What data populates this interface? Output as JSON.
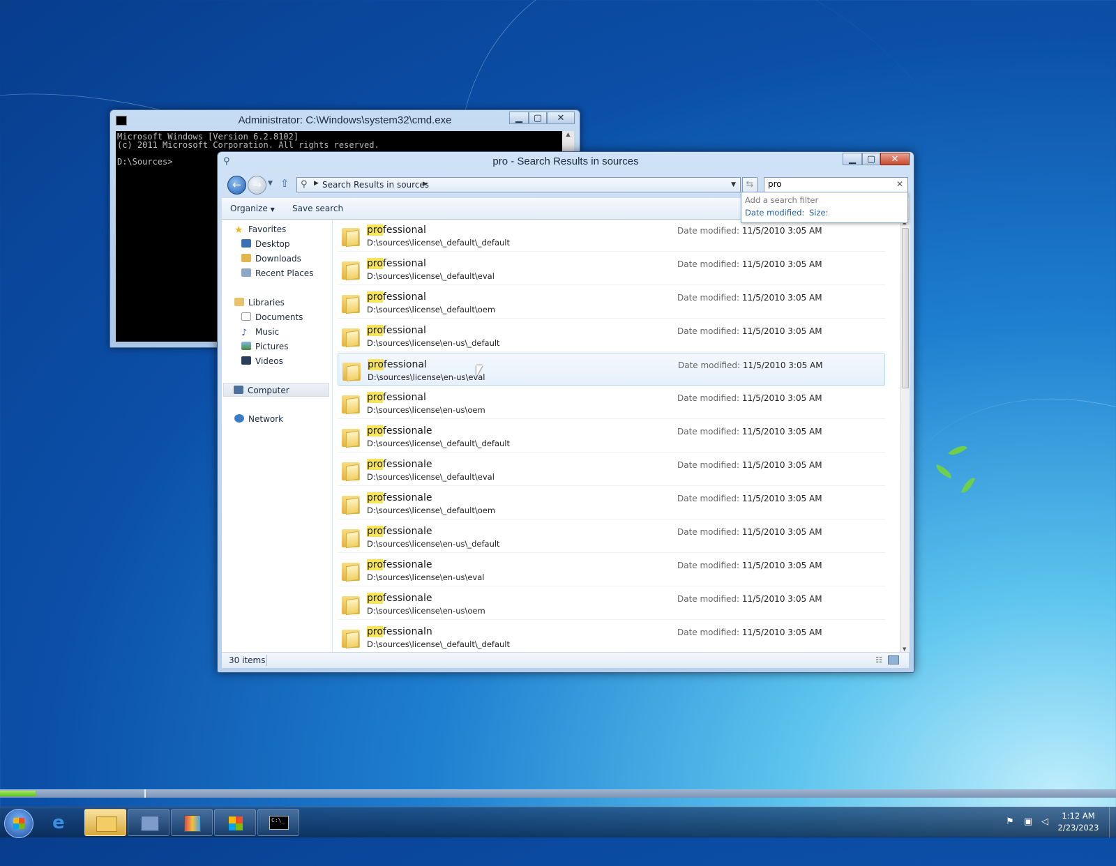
{
  "cmd": {
    "title": "Administrator: C:\\Windows\\system32\\cmd.exe",
    "line1": "Microsoft Windows [Version 6.2.8102]",
    "line2": "(c) 2011 Microsoft Corporation. All rights reserved.",
    "line3": "D:\\Sources>"
  },
  "explorer": {
    "title": "pro - Search Results in sources",
    "address": "Search Results in sources",
    "search_value": "pro",
    "filter_heading": "Add a search filter",
    "filter_date": "Date modified:",
    "filter_size": "Size:",
    "toolbar": {
      "organize": "Organize",
      "save_search": "Save search"
    },
    "status": "30 items",
    "nav": {
      "favorites": "Favorites",
      "desktop": "Desktop",
      "downloads": "Downloads",
      "recent": "Recent Places",
      "libraries": "Libraries",
      "documents": "Documents",
      "music": "Music",
      "pictures": "Pictures",
      "videos": "Videos",
      "computer": "Computer",
      "network": "Network"
    },
    "dm_label": "Date modified:",
    "rows": [
      {
        "hl": "pro",
        "rest": "fessional",
        "path": "D:\\sources\\license\\_default\\_default",
        "date": "11/5/2010 3:05 AM"
      },
      {
        "hl": "pro",
        "rest": "fessional",
        "path": "D:\\sources\\license\\_default\\eval",
        "date": "11/5/2010 3:05 AM"
      },
      {
        "hl": "pro",
        "rest": "fessional",
        "path": "D:\\sources\\license\\_default\\oem",
        "date": "11/5/2010 3:05 AM"
      },
      {
        "hl": "pro",
        "rest": "fessional",
        "path": "D:\\sources\\license\\en-us\\_default",
        "date": "11/5/2010 3:05 AM"
      },
      {
        "hl": "pro",
        "rest": "fessional",
        "path": "D:\\sources\\license\\en-us\\eval",
        "date": "11/5/2010 3:05 AM"
      },
      {
        "hl": "pro",
        "rest": "fessional",
        "path": "D:\\sources\\license\\en-us\\oem",
        "date": "11/5/2010 3:05 AM"
      },
      {
        "hl": "pro",
        "rest": "fessionale",
        "path": "D:\\sources\\license\\_default\\_default",
        "date": "11/5/2010 3:05 AM"
      },
      {
        "hl": "pro",
        "rest": "fessionale",
        "path": "D:\\sources\\license\\_default\\eval",
        "date": "11/5/2010 3:05 AM"
      },
      {
        "hl": "pro",
        "rest": "fessionale",
        "path": "D:\\sources\\license\\_default\\oem",
        "date": "11/5/2010 3:05 AM"
      },
      {
        "hl": "pro",
        "rest": "fessionale",
        "path": "D:\\sources\\license\\en-us\\_default",
        "date": "11/5/2010 3:05 AM"
      },
      {
        "hl": "pro",
        "rest": "fessionale",
        "path": "D:\\sources\\license\\en-us\\eval",
        "date": "11/5/2010 3:05 AM"
      },
      {
        "hl": "pro",
        "rest": "fessionale",
        "path": "D:\\sources\\license\\en-us\\oem",
        "date": "11/5/2010 3:05 AM"
      },
      {
        "hl": "pro",
        "rest": "fessionaln",
        "path": "D:\\sources\\license\\_default\\_default",
        "date": "11/5/2010 3:05 AM"
      }
    ]
  },
  "clock": {
    "time": "1:12 AM",
    "date": "2/23/2023"
  },
  "colors": {
    "highlight": "#f7e45c",
    "link": "#1f5fa8"
  }
}
